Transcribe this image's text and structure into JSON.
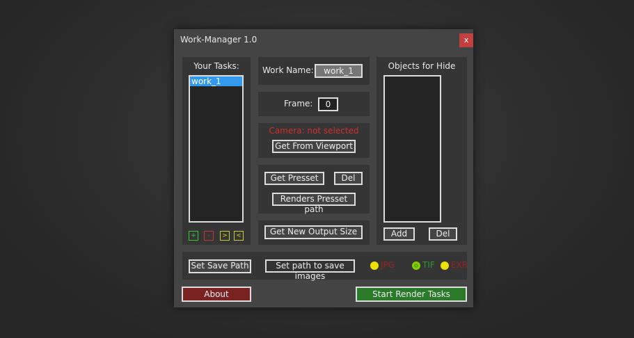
{
  "window": {
    "title": "Work-Manager 1.0",
    "close": "x"
  },
  "tasks": {
    "label": "Your Tasks:",
    "items": [
      "work_1"
    ],
    "buttons": [
      "+",
      "-",
      ">",
      "<"
    ]
  },
  "work_name": {
    "label": "Work Name:",
    "value": "work_1"
  },
  "frame": {
    "label": "Frame:",
    "value": "0"
  },
  "camera": {
    "status": "Camera: not selected",
    "button": "Get From Viewport"
  },
  "presset": {
    "get": "Get Presset",
    "del": "Del",
    "path": "Renders Presset path"
  },
  "output": {
    "button": "Get New Output Size"
  },
  "hide": {
    "label": "Objects for Hide",
    "add": "Add",
    "del": "Del"
  },
  "save": {
    "set_save_path": "Set Save Path",
    "set_images_path": "Set path to save images",
    "formats": [
      {
        "label": "JPG",
        "selected": false
      },
      {
        "label": "TIF",
        "selected": true
      },
      {
        "label": "EXR",
        "selected": false
      }
    ]
  },
  "footer": {
    "about": "About",
    "start": "Start Render Tasks"
  }
}
